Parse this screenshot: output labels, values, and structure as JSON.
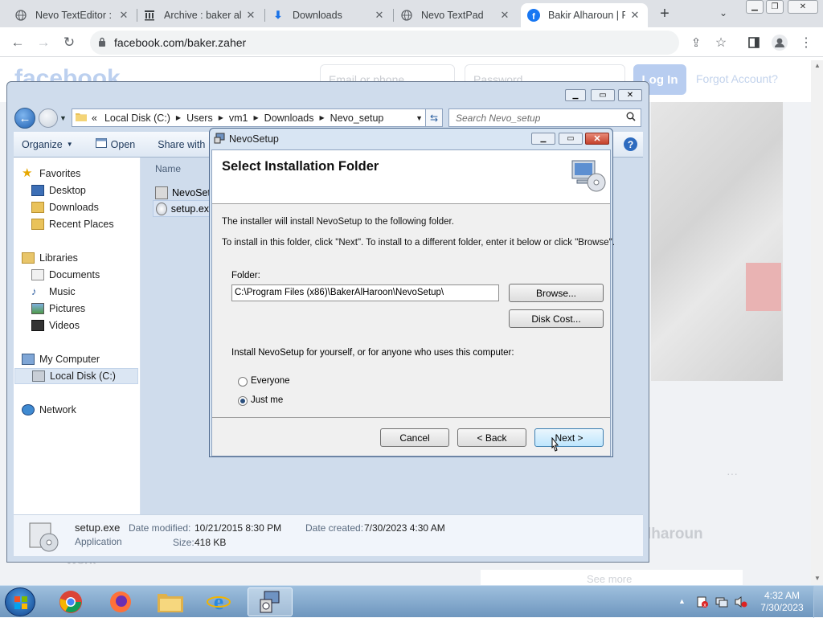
{
  "browser": {
    "tabs": [
      {
        "title": "Nevo TextEditor : N",
        "icon": "globe-icon"
      },
      {
        "title": "Archive : baker alh",
        "icon": "archive-icon"
      },
      {
        "title": "Downloads",
        "icon": "download-icon"
      },
      {
        "title": "Nevo TextPad",
        "icon": "globe-icon"
      },
      {
        "title": "Bakir Alharoun | F",
        "icon": "facebook-icon"
      }
    ],
    "url": "facebook.com/baker.zaher"
  },
  "facebook": {
    "logo": "facebook",
    "email_placeholder": "Email or phone",
    "password_placeholder": "Password",
    "login_label": "Log In",
    "forgot_label": "Forgot Account?",
    "profile_name": "lharoun",
    "work_label": "Work",
    "see_more": "See more",
    "dots": "···"
  },
  "explorer": {
    "breadcrumb": [
      "Local Disk (C:)",
      "Users",
      "vm1",
      "Downloads",
      "Nevo_setup"
    ],
    "breadcrumb_prefix": "«",
    "search_placeholder": "Search Nevo_setup",
    "toolbar": {
      "organize": "Organize",
      "open": "Open",
      "share_with": "Share with"
    },
    "nav": {
      "favorites": "Favorites",
      "fav_items": [
        "Desktop",
        "Downloads",
        "Recent Places"
      ],
      "libraries": "Libraries",
      "lib_items": [
        "Documents",
        "Music",
        "Pictures",
        "Videos"
      ],
      "my_computer": "My Computer",
      "local_disk": "Local Disk (C:)",
      "network": "Network"
    },
    "column_name": "Name",
    "files": [
      "NevoSetup",
      "setup.exe"
    ],
    "details": {
      "filename": "setup.exe",
      "type": "Application",
      "date_modified_label": "Date modified:",
      "date_modified": "10/21/2015 8:30 PM",
      "size_label": "Size:",
      "size": "418 KB",
      "date_created_label": "Date created:",
      "date_created": "7/30/2023 4:30 AM"
    }
  },
  "dialog": {
    "title": "NevoSetup",
    "heading": "Select Installation Folder",
    "line1": "The installer will install NevoSetup to the following folder.",
    "line2": "To install in this folder, click \"Next\". To install to a different folder, enter it below or click \"Browse\".",
    "folder_label": "Folder:",
    "folder_value": "C:\\Program Files (x86)\\BakerAlHaroon\\NevoSetup\\",
    "browse": "Browse...",
    "disk_cost": "Disk Cost...",
    "install_for": "Install NevoSetup for yourself, or for anyone who uses this computer:",
    "opt_everyone": "Everyone",
    "opt_justme": "Just me",
    "selected_option": "Just me",
    "cancel": "Cancel",
    "back": "< Back",
    "next": "Next >"
  },
  "taskbar": {
    "time": "4:32 AM",
    "date": "7/30/2023"
  }
}
